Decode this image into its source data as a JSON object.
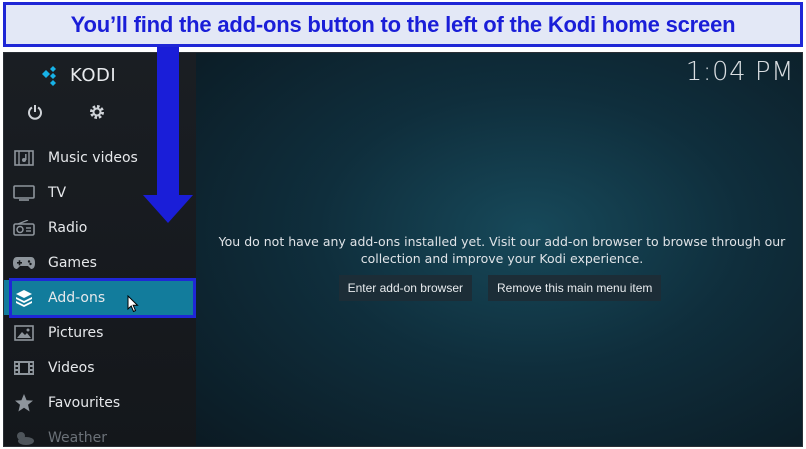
{
  "banner": {
    "text": "You’ll find the add-ons button to the left of the Kodi home screen"
  },
  "app": {
    "name": "KODI"
  },
  "clock": "1:04 PM",
  "sidebar": {
    "items": [
      {
        "label": "Music videos",
        "icon": "music-video-icon"
      },
      {
        "label": "TV",
        "icon": "tv-icon"
      },
      {
        "label": "Radio",
        "icon": "radio-icon"
      },
      {
        "label": "Games",
        "icon": "gamepad-icon"
      },
      {
        "label": "Add-ons",
        "icon": "addons-box-icon",
        "active": true
      },
      {
        "label": "Pictures",
        "icon": "picture-icon"
      },
      {
        "label": "Videos",
        "icon": "film-icon"
      },
      {
        "label": "Favourites",
        "icon": "star-icon"
      },
      {
        "label": "Weather",
        "icon": "weather-icon"
      }
    ]
  },
  "main": {
    "message": "You do not have any add-ons installed yet. Visit our add-on browser to browse through our collection and improve your Kodi experience.",
    "buttons": {
      "browser": "Enter add-on browser",
      "remove": "Remove this main menu item"
    }
  },
  "colors": {
    "accent": "#127c9c",
    "annotation": "#1f27d6"
  }
}
